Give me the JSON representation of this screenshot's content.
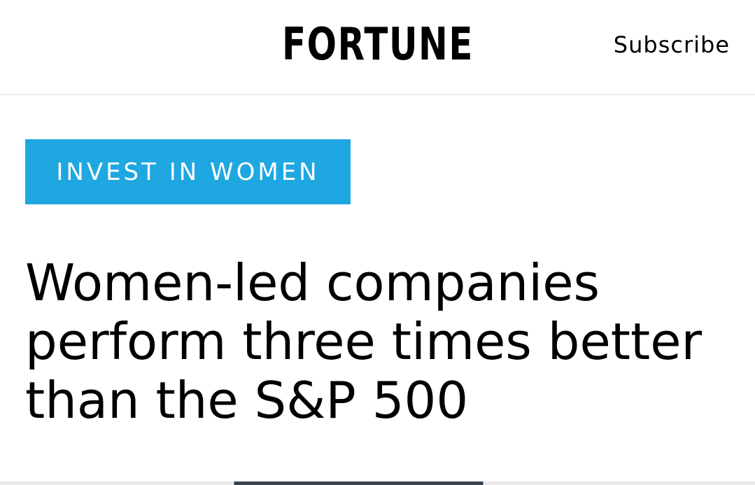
{
  "header": {
    "logo": "FORTUNE",
    "subscribe_label": "Subscribe"
  },
  "article": {
    "category": "INVEST IN WOMEN",
    "headline_lines": [
      "Women-led companies",
      "perform three times better",
      "than the S&P 500"
    ]
  },
  "colors": {
    "category_background": "#1fa7e1",
    "text": "#000000",
    "background": "#ffffff"
  }
}
